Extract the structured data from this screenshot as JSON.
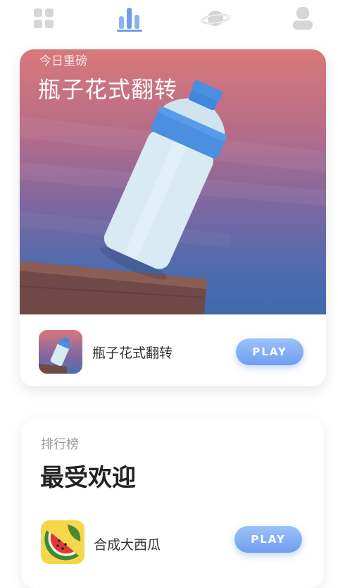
{
  "nav": {
    "items": [
      {
        "icon": "apps-grid-icon"
      },
      {
        "icon": "bar-chart-icon",
        "active": true
      },
      {
        "icon": "planet-icon"
      },
      {
        "icon": "person-icon"
      }
    ],
    "active_color": "#6f9ee8",
    "inactive_color": "#d6d6d6"
  },
  "featured": {
    "kicker": "今日重磅",
    "title": "瓶子花式翻转",
    "app_name": "瓶子花式翻转",
    "play_label": "PLAY"
  },
  "ranking": {
    "kicker": "排行榜",
    "title": "最受欢迎",
    "apps": [
      {
        "name": "合成大西瓜",
        "play_label": "PLAY",
        "icon": "watermelon-icon"
      }
    ]
  }
}
